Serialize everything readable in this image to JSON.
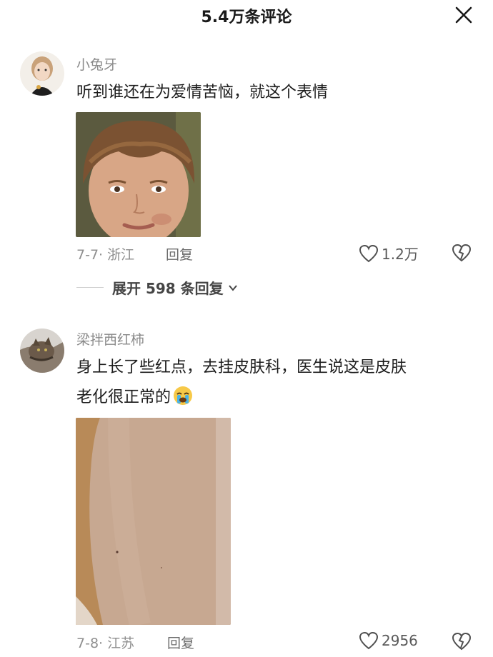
{
  "header": {
    "title": "5.4万条评论"
  },
  "comments": [
    {
      "username": "小兔牙",
      "text": "听到谁还在为爱情苦恼，就这个表情",
      "date_location": "7-7· 浙江",
      "reply_label": "回复",
      "likes": "1.2万",
      "expand": "展开 598 条回复"
    },
    {
      "username": "梁拌西红柿",
      "text_line1": "身上长了些红点，去挂皮肤科，医生说这是皮肤",
      "text_line2": "老化很正常的",
      "date_location": "7-8· 江苏",
      "reply_label": "回复",
      "likes": "2956"
    }
  ],
  "icons": [
    "close-icon",
    "heart-icon",
    "broken-heart-icon",
    "chevron-down-icon",
    "crying-emoji-icon"
  ],
  "colors": {
    "username": "#8a8a8a",
    "meta": "#8f8f8f",
    "text": "#1c1c1c"
  }
}
